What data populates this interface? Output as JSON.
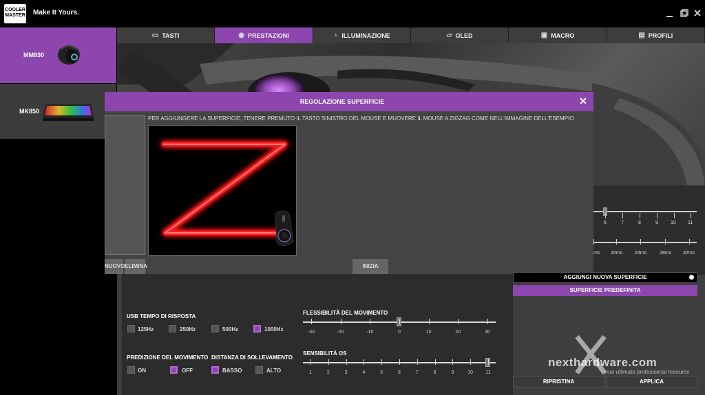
{
  "app": {
    "logo_text": "COOLER MASTER",
    "tagline": "Make It Yours.",
    "window_controls": [
      "minimize-icon",
      "restore-icon",
      "close-icon"
    ]
  },
  "devices": [
    {
      "label": "MM830",
      "selected": true
    },
    {
      "label": "MK850",
      "selected": false
    }
  ],
  "tabs": [
    {
      "label": "TASTI",
      "icon": "keyboard-icon",
      "active": false
    },
    {
      "label": "PRESTAZIONI",
      "icon": "speedometer-icon",
      "active": true
    },
    {
      "label": "ILLUMINAZIONE",
      "icon": "bulb-icon",
      "active": false
    },
    {
      "label": "OLED",
      "icon": "oled-icon",
      "active": false
    },
    {
      "label": "MACRO",
      "icon": "macro-icon",
      "active": false
    },
    {
      "label": "PROFILI",
      "icon": "profile-icon",
      "active": false
    }
  ],
  "modal": {
    "title": "REGOLAZIONE SUPERFICIE",
    "instruction": "PER AGGIUNGERE LA SUPERFICIE, TENERE PREMUTO IL TASTO SINISTRO DEL MOUSE E MUOVERE IL MOUSE A ZIGZAG COME NELL'IMMAGINE DELL'ESEMPIO",
    "buttons": {
      "new": "NUOVO",
      "delete": "ELIMINA",
      "start": "INIZIA"
    }
  },
  "right_panel": {
    "slider1_labels": [
      "6",
      "7",
      "8",
      "9",
      "10",
      "11"
    ],
    "slider2_labels": [
      "ms",
      "20ms",
      "24ms",
      "28ms",
      "32ms"
    ]
  },
  "settings": {
    "usb_response": {
      "label": "USB TEMPO DI RISPOSTA",
      "options": [
        {
          "label": "125Hz",
          "checked": false
        },
        {
          "label": "250Hz",
          "checked": false
        },
        {
          "label": "500Hz",
          "checked": false
        },
        {
          "label": "1000Hz",
          "checked": true
        }
      ]
    },
    "motion_prediction": {
      "label": "PREDIZIONE DEL MOVIMENTO",
      "options": [
        {
          "label": "ON",
          "checked": false
        },
        {
          "label": "OFF",
          "checked": true
        }
      ]
    },
    "lift_distance": {
      "label": "DISTANZA DI SOLLEVAMENTO",
      "options": [
        {
          "label": "BASSO",
          "checked": true
        },
        {
          "label": "ALTO",
          "checked": false
        }
      ]
    },
    "movement_flex": {
      "label": "FLESSIBILITÀ DEL MOVIMENTO",
      "ticks": [
        "-30",
        "-20",
        "-10",
        "0",
        "10",
        "20",
        "30"
      ],
      "value": 0
    },
    "os_sensitivity": {
      "label": "SENSIBILITÀ OS",
      "ticks": [
        "1",
        "2",
        "3",
        "4",
        "5",
        "6",
        "7",
        "8",
        "9",
        "10",
        "11"
      ],
      "value": 11
    }
  },
  "surface_buttons": {
    "add": "AGGIUNGI NUOVA SUPERFICIE",
    "default": "SUPERFICIE PREDEFINITA"
  },
  "actions": {
    "reset": "RIPRISTINA",
    "apply": "APPLICA"
  },
  "watermark": {
    "brand": "nexthardware.com",
    "sub": "your ultimate professional resource"
  },
  "colors": {
    "accent": "#8c46ad",
    "background": "#000000",
    "panel": "#444444"
  }
}
